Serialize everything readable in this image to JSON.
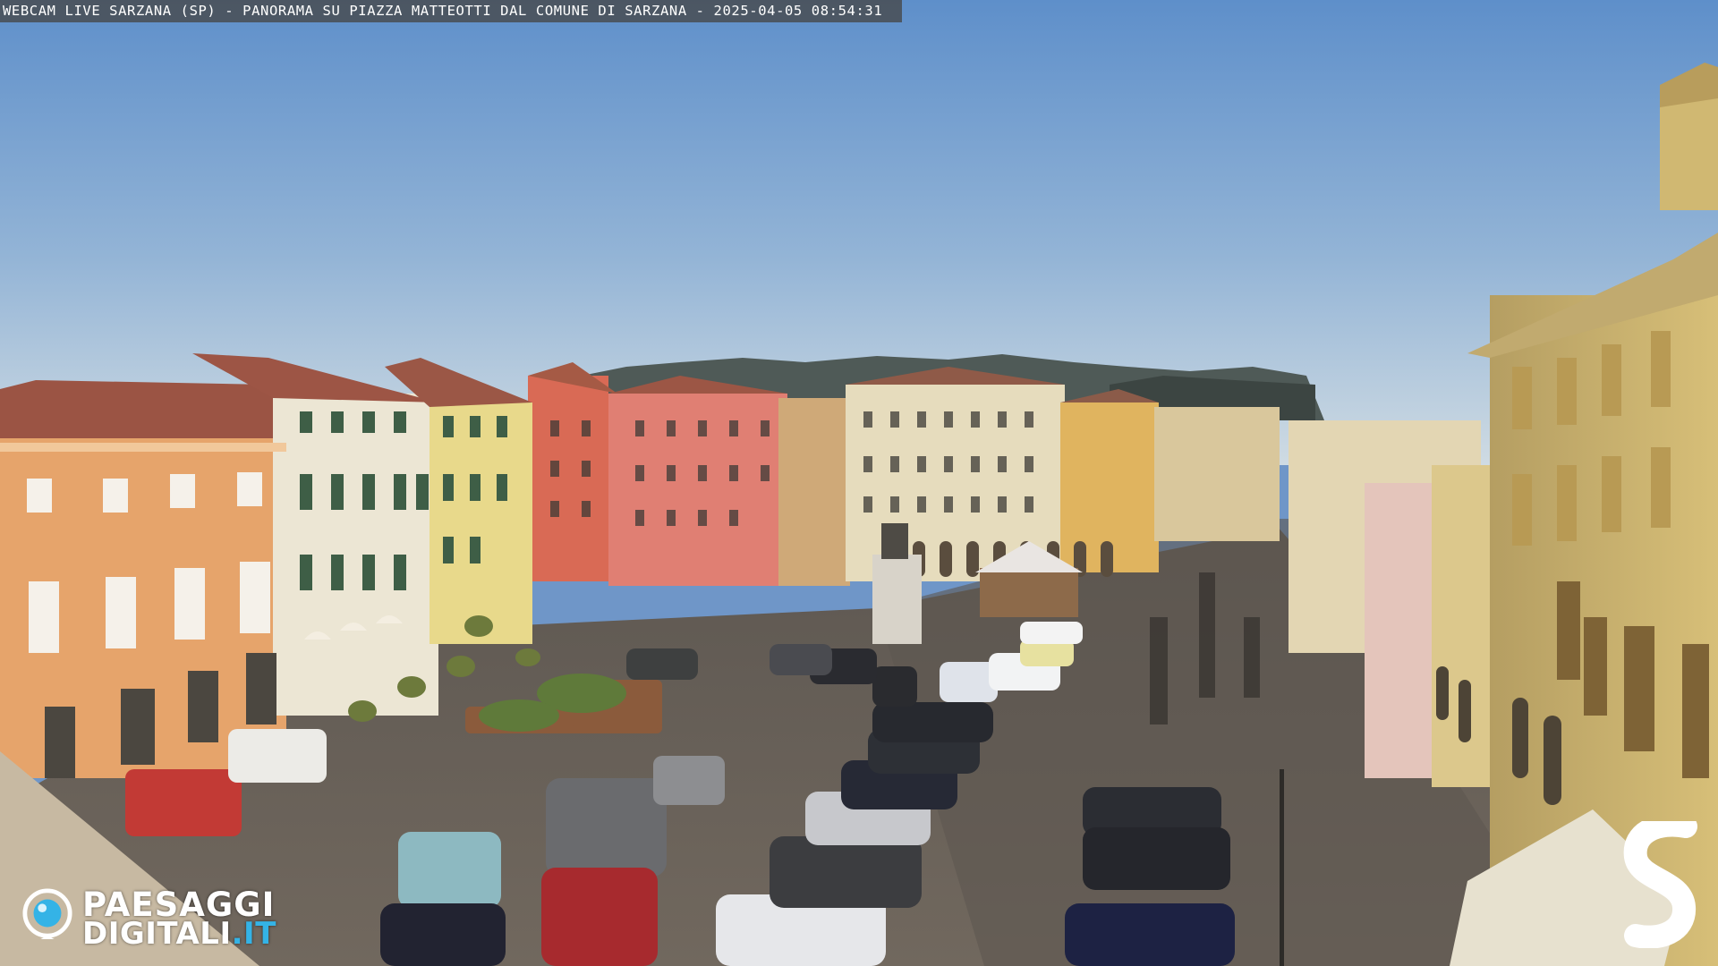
{
  "overlay": {
    "caption": "WEBCAM LIVE SARZANA (SP) - PANORAMA SU PIAZZA MATTEOTTI DAL COMUNE DI SARZANA - 2025-04-05  08:54:31"
  },
  "branding": {
    "left_logo_line1": "PAESAGGI",
    "left_logo_line2": "DIGITALI",
    "left_logo_tld": ".IT",
    "left_logo_accent": "#34b3e6",
    "right_logo_letter": "S"
  },
  "colors": {
    "sky_top": "#5f8fc9",
    "sky_bottom": "#c9d6e0",
    "pavement": "#6b6258",
    "building_orange": "#e5a56c",
    "building_cream": "#ede6d2",
    "building_yellow": "#e9d98a",
    "building_red": "#d7644f",
    "building_pink": "#df7c72"
  }
}
